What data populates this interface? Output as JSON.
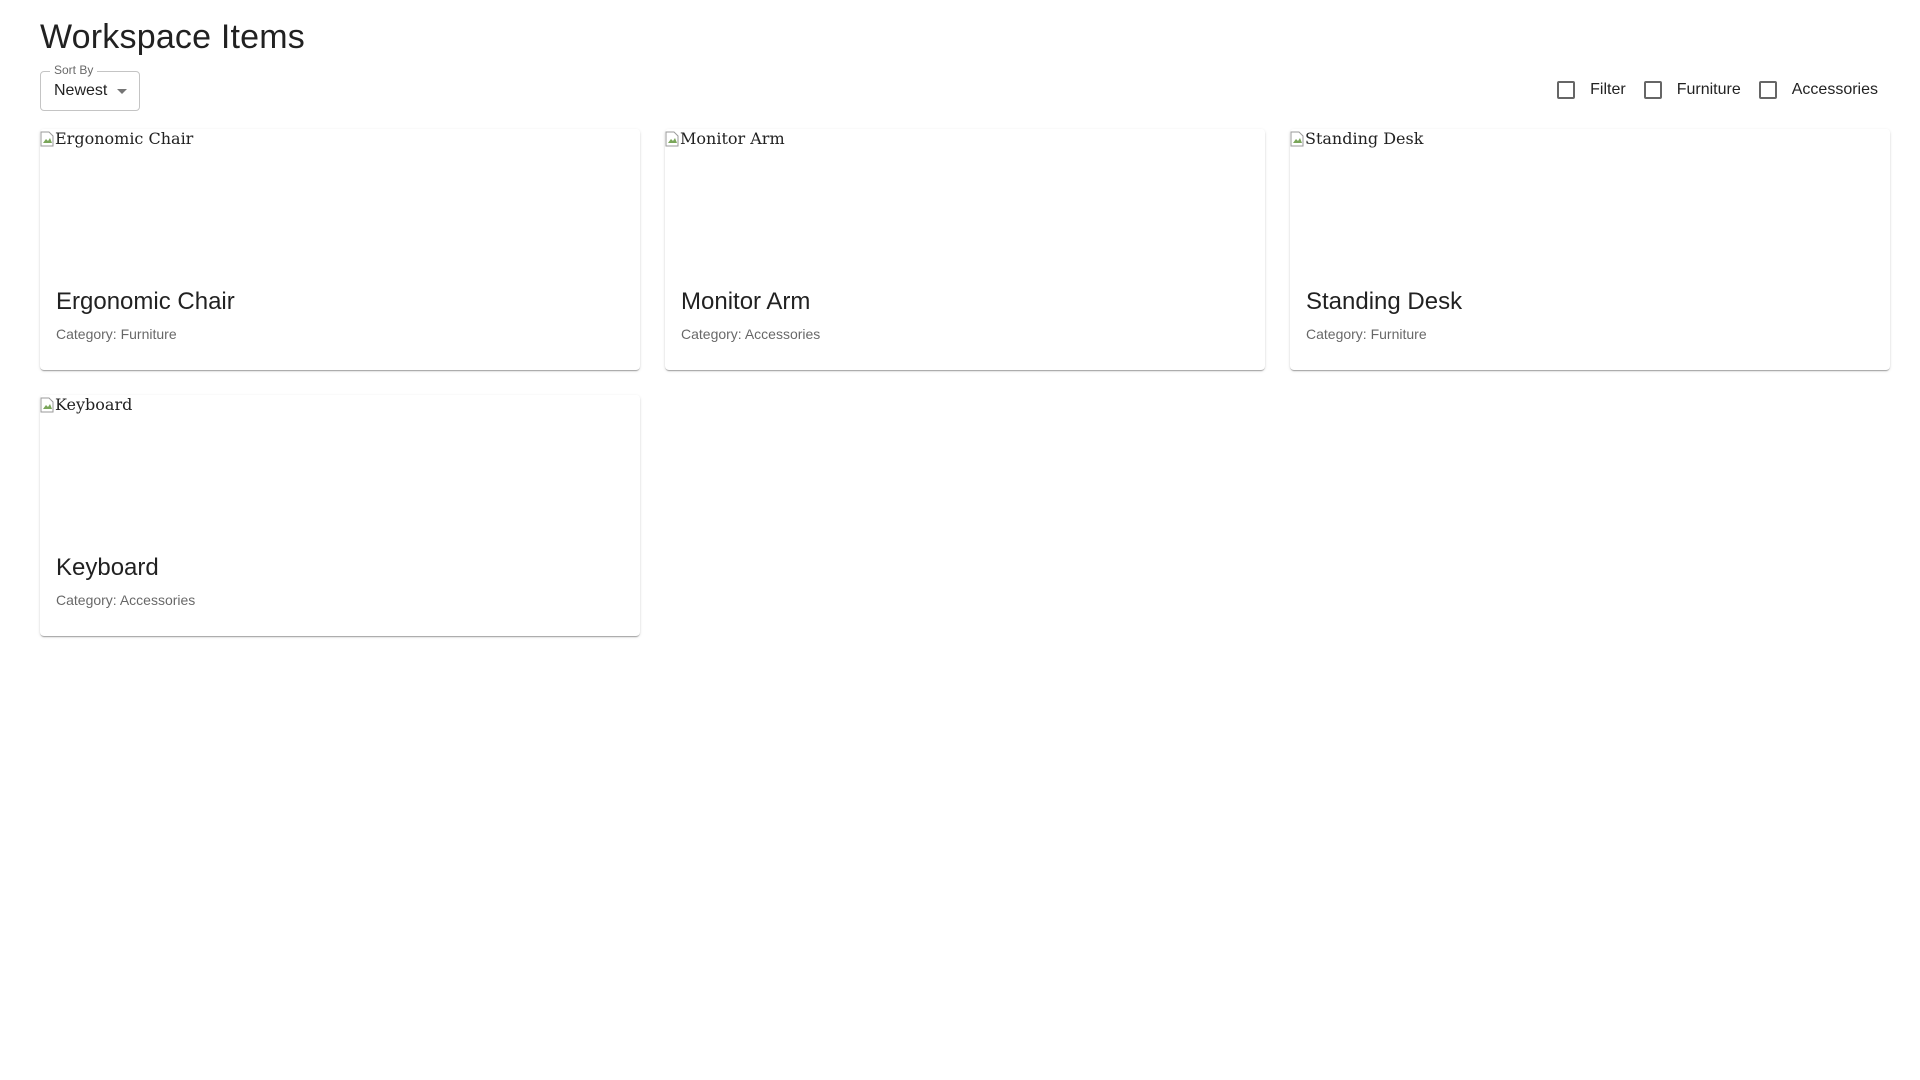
{
  "page": {
    "title": "Workspace Items"
  },
  "sort": {
    "label": "Sort By",
    "value": "Newest",
    "icon": "arrow-drop-down-icon"
  },
  "filters": [
    {
      "label": "Filter",
      "checked": false
    },
    {
      "label": "Furniture",
      "checked": false
    },
    {
      "label": "Accessories",
      "checked": false
    }
  ],
  "items": [
    {
      "name": "Ergonomic Chair",
      "image_alt": "Ergonomic Chair",
      "category": "Category: Furniture"
    },
    {
      "name": "Monitor Arm",
      "image_alt": "Monitor Arm",
      "category": "Category: Accessories"
    },
    {
      "name": "Standing Desk",
      "image_alt": "Standing Desk",
      "category": "Category: Furniture"
    },
    {
      "name": "Keyboard",
      "image_alt": "Keyboard",
      "category": "Category: Accessories"
    }
  ]
}
